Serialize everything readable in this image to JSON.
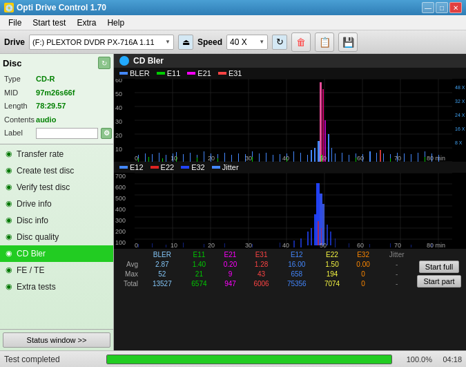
{
  "titlebar": {
    "icon": "💿",
    "title": "Opti Drive Control 1.70",
    "minimize": "—",
    "restore": "□",
    "close": "✕"
  },
  "menubar": {
    "items": [
      "File",
      "Start test",
      "Extra",
      "Help"
    ]
  },
  "toolbar": {
    "drive_label": "Drive",
    "drive_value": "(F:)  PLEXTOR DVDR   PX-716A 1.11",
    "speed_label": "Speed",
    "speed_value": "40 X"
  },
  "disc": {
    "title": "Disc",
    "type_label": "Type",
    "type_value": "CD-R",
    "mid_label": "MID",
    "mid_value": "97m26s66f",
    "length_label": "Length",
    "length_value": "78:29.57",
    "contents_label": "Contents",
    "contents_value": "audio",
    "label_label": "Label",
    "label_value": ""
  },
  "sidebar": {
    "items": [
      {
        "id": "transfer-rate",
        "label": "Transfer rate",
        "active": false
      },
      {
        "id": "create-test-disc",
        "label": "Create test disc",
        "active": false
      },
      {
        "id": "verify-test-disc",
        "label": "Verify test disc",
        "active": false
      },
      {
        "id": "drive-info",
        "label": "Drive info",
        "active": false
      },
      {
        "id": "disc-info",
        "label": "Disc info",
        "active": false
      },
      {
        "id": "disc-quality",
        "label": "Disc quality",
        "active": false
      },
      {
        "id": "cd-bler",
        "label": "CD Bler",
        "active": true
      },
      {
        "id": "fe-te",
        "label": "FE / TE",
        "active": false
      },
      {
        "id": "extra-tests",
        "label": "Extra tests",
        "active": false
      }
    ],
    "status_label": "Status window >>"
  },
  "chart": {
    "title": "CD Bler",
    "top_legend": [
      {
        "label": "BLER",
        "color": "#4488ff"
      },
      {
        "label": "E11",
        "color": "#00cc00"
      },
      {
        "label": "E21",
        "color": "#ff00ff"
      },
      {
        "label": "E31",
        "color": "#ff4444"
      }
    ],
    "bottom_legend": [
      {
        "label": "E12",
        "color": "#4488ff"
      },
      {
        "label": "E22",
        "color": "#dd2222"
      },
      {
        "label": "E32",
        "color": "#2244ff"
      },
      {
        "label": "Jitter",
        "color": "#4488ff"
      }
    ],
    "y_axis_top": [
      "60",
      "50",
      "40",
      "30",
      "20",
      "10",
      "0"
    ],
    "y_axis_right_top": [
      "48 X",
      "32 X",
      "24 X",
      "16 X",
      "8 X"
    ],
    "x_axis_top": [
      "0",
      "10",
      "20",
      "30",
      "40",
      "50",
      "60",
      "70",
      "80 min"
    ],
    "y_axis_bottom": [
      "700",
      "600",
      "500",
      "400",
      "300",
      "200",
      "100",
      "0"
    ],
    "x_axis_bottom": [
      "0",
      "10",
      "20",
      "30",
      "40",
      "50",
      "60",
      "70",
      "80 min"
    ]
  },
  "stats": {
    "headers": [
      "",
      "BLER",
      "E11",
      "E21",
      "E31",
      "E12",
      "E22",
      "E32",
      "Jitter",
      ""
    ],
    "rows": [
      {
        "label": "Avg",
        "bler": "2.87",
        "e11": "1.40",
        "e21": "0.20",
        "e31": "1.28",
        "e12": "16.00",
        "e22": "1.50",
        "e32": "0.00",
        "jitter": "-"
      },
      {
        "label": "Max",
        "bler": "52",
        "e11": "21",
        "e21": "9",
        "e31": "43",
        "e12": "658",
        "e22": "194",
        "e32": "0",
        "jitter": "-"
      },
      {
        "label": "Total",
        "bler": "13527",
        "e11": "6574",
        "e21": "947",
        "e31": "6006",
        "e12": "75356",
        "e22": "7074",
        "e32": "0",
        "jitter": "-"
      }
    ],
    "btn_full": "Start full",
    "btn_part": "Start part"
  },
  "statusbar": {
    "text": "Test completed",
    "progress": 100,
    "progress_text": "100.0%",
    "time": "04:18"
  }
}
